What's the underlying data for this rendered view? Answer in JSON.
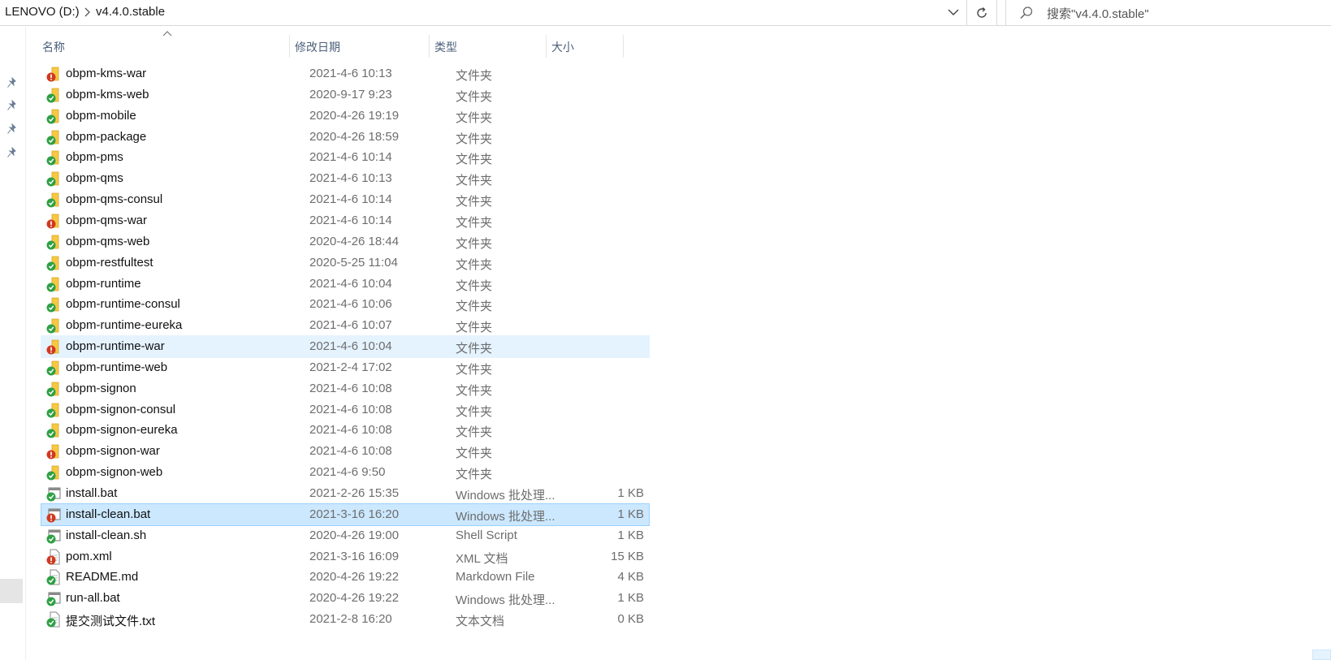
{
  "address": {
    "drive": "LENOVO (D:)",
    "folder": "v4.4.0.stable"
  },
  "search": {
    "placeholder": "搜索\"v4.4.0.stable\""
  },
  "columns": {
    "name": "名称",
    "date": "修改日期",
    "type": "类型",
    "size": "大小"
  },
  "status_colors": {
    "ok": "#2ea044",
    "error": "#d0391f",
    "folder": "#f6c843",
    "selected": "#cce8ff",
    "hover": "#e5f3ff"
  },
  "files": [
    {
      "name": "obpm-kms-war",
      "date": "2021-4-6 10:13",
      "type": "文件夹",
      "size": "",
      "kind": "folder",
      "status": "error"
    },
    {
      "name": "obpm-kms-web",
      "date": "2020-9-17 9:23",
      "type": "文件夹",
      "size": "",
      "kind": "folder",
      "status": "ok"
    },
    {
      "name": "obpm-mobile",
      "date": "2020-4-26 19:19",
      "type": "文件夹",
      "size": "",
      "kind": "folder",
      "status": "ok"
    },
    {
      "name": "obpm-package",
      "date": "2020-4-26 18:59",
      "type": "文件夹",
      "size": "",
      "kind": "folder",
      "status": "ok"
    },
    {
      "name": "obpm-pms",
      "date": "2021-4-6 10:14",
      "type": "文件夹",
      "size": "",
      "kind": "folder",
      "status": "ok"
    },
    {
      "name": "obpm-qms",
      "date": "2021-4-6 10:13",
      "type": "文件夹",
      "size": "",
      "kind": "folder",
      "status": "ok"
    },
    {
      "name": "obpm-qms-consul",
      "date": "2021-4-6 10:14",
      "type": "文件夹",
      "size": "",
      "kind": "folder",
      "status": "ok"
    },
    {
      "name": "obpm-qms-war",
      "date": "2021-4-6 10:14",
      "type": "文件夹",
      "size": "",
      "kind": "folder",
      "status": "error"
    },
    {
      "name": "obpm-qms-web",
      "date": "2020-4-26 18:44",
      "type": "文件夹",
      "size": "",
      "kind": "folder",
      "status": "ok"
    },
    {
      "name": "obpm-restfultest",
      "date": "2020-5-25 11:04",
      "type": "文件夹",
      "size": "",
      "kind": "folder",
      "status": "ok"
    },
    {
      "name": "obpm-runtime",
      "date": "2021-4-6 10:04",
      "type": "文件夹",
      "size": "",
      "kind": "folder",
      "status": "ok"
    },
    {
      "name": "obpm-runtime-consul",
      "date": "2021-4-6 10:06",
      "type": "文件夹",
      "size": "",
      "kind": "folder",
      "status": "ok"
    },
    {
      "name": "obpm-runtime-eureka",
      "date": "2021-4-6 10:07",
      "type": "文件夹",
      "size": "",
      "kind": "folder",
      "status": "ok"
    },
    {
      "name": "obpm-runtime-war",
      "date": "2021-4-6 10:04",
      "type": "文件夹",
      "size": "",
      "kind": "folder",
      "status": "error",
      "state": "hover"
    },
    {
      "name": "obpm-runtime-web",
      "date": "2021-2-4 17:02",
      "type": "文件夹",
      "size": "",
      "kind": "folder",
      "status": "ok"
    },
    {
      "name": "obpm-signon",
      "date": "2021-4-6 10:08",
      "type": "文件夹",
      "size": "",
      "kind": "folder",
      "status": "ok"
    },
    {
      "name": "obpm-signon-consul",
      "date": "2021-4-6 10:08",
      "type": "文件夹",
      "size": "",
      "kind": "folder",
      "status": "ok"
    },
    {
      "name": "obpm-signon-eureka",
      "date": "2021-4-6 10:08",
      "type": "文件夹",
      "size": "",
      "kind": "folder",
      "status": "ok"
    },
    {
      "name": "obpm-signon-war",
      "date": "2021-4-6 10:08",
      "type": "文件夹",
      "size": "",
      "kind": "folder",
      "status": "error"
    },
    {
      "name": "obpm-signon-web",
      "date": "2021-4-6 9:50",
      "type": "文件夹",
      "size": "",
      "kind": "folder",
      "status": "ok"
    },
    {
      "name": "install.bat",
      "date": "2021-2-26 15:35",
      "type": "Windows 批处理...",
      "size": "1 KB",
      "kind": "bat",
      "status": "ok"
    },
    {
      "name": "install-clean.bat",
      "date": "2021-3-16 16:20",
      "type": "Windows 批处理...",
      "size": "1 KB",
      "kind": "bat",
      "status": "error",
      "state": "selected"
    },
    {
      "name": "install-clean.sh",
      "date": "2020-4-26 19:00",
      "type": "Shell Script",
      "size": "1 KB",
      "kind": "bat",
      "status": "ok"
    },
    {
      "name": "pom.xml",
      "date": "2021-3-16 16:09",
      "type": "XML 文档",
      "size": "15 KB",
      "kind": "doc",
      "status": "error"
    },
    {
      "name": "README.md",
      "date": "2020-4-26 19:22",
      "type": "Markdown File",
      "size": "4 KB",
      "kind": "doc",
      "status": "ok"
    },
    {
      "name": "run-all.bat",
      "date": "2020-4-26 19:22",
      "type": "Windows 批处理...",
      "size": "1 KB",
      "kind": "bat",
      "status": "ok"
    },
    {
      "name": "提交测试文件.txt",
      "date": "2021-2-8 16:20",
      "type": "文本文档",
      "size": "0 KB",
      "kind": "txt",
      "status": "ok"
    }
  ]
}
